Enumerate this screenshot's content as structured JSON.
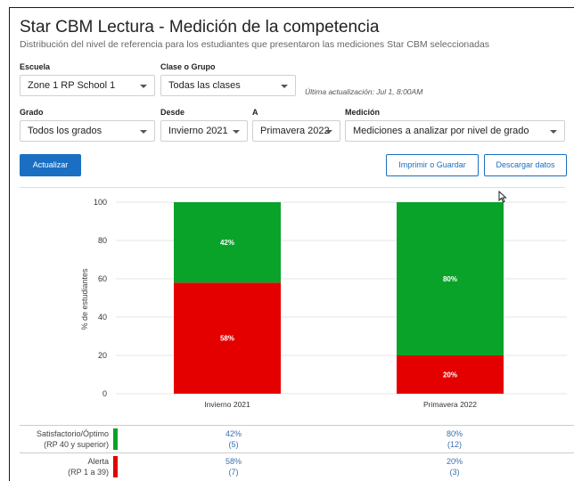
{
  "header": {
    "title": "Star CBM Lectura - Medición de la competencia",
    "subtitle": "Distribución del nivel de referencia para los estudiantes que presentaron las mediciones Star CBM seleccionadas"
  },
  "filters": {
    "school_label": "Escuela",
    "school_value": "Zone 1 RP School 1",
    "class_label": "Clase o Grupo",
    "class_value": "Todas las clases",
    "last_updated": "Última actualización: Jul 1, 8:00AM",
    "grade_label": "Grado",
    "grade_value": "Todos los grados",
    "from_label": "Desde",
    "from_value": "Invierno 2021",
    "to_label": "A",
    "to_value": "Primavera 2022",
    "measure_label": "Medición",
    "measure_value": "Mediciones a analizar por nivel de grado"
  },
  "actions": {
    "update_label": "Actualizar",
    "print_label": "Imprimir o Guardar",
    "download_label": "Descargar datos"
  },
  "colors": {
    "satisfactory": "#0aa32a",
    "alert": "#e50000",
    "primary": "#1a6fc2"
  },
  "chart_data": {
    "type": "bar",
    "stacked": true,
    "categories": [
      "Invierno 2021",
      "Primavera 2022"
    ],
    "series": [
      {
        "name": "Alerta",
        "values": [
          58,
          20
        ],
        "labels": [
          "58%",
          "20%"
        ],
        "color": "#e50000"
      },
      {
        "name": "Satisfactorio/Óptimo",
        "values": [
          42,
          80
        ],
        "labels": [
          "42%",
          "80%"
        ],
        "color": "#0aa32a"
      }
    ],
    "ylabel": "% de estudiantes",
    "ylim": [
      0,
      100
    ],
    "yticks": [
      "0",
      "20",
      "40",
      "60",
      "80",
      "100"
    ]
  },
  "table": {
    "rows": [
      {
        "label_line1": "Satisfactorio/Óptimo",
        "label_line2": "(RP 40 y superior)",
        "color": "#0aa32a",
        "cells": [
          {
            "pct": "42%",
            "count": "(5)"
          },
          {
            "pct": "80%",
            "count": "(12)"
          }
        ]
      },
      {
        "label_line1": "Alerta",
        "label_line2": "(RP 1 a 39)",
        "color": "#e50000",
        "cells": [
          {
            "pct": "58%",
            "count": "(7)"
          },
          {
            "pct": "20%",
            "count": "(3)"
          }
        ]
      }
    ]
  }
}
